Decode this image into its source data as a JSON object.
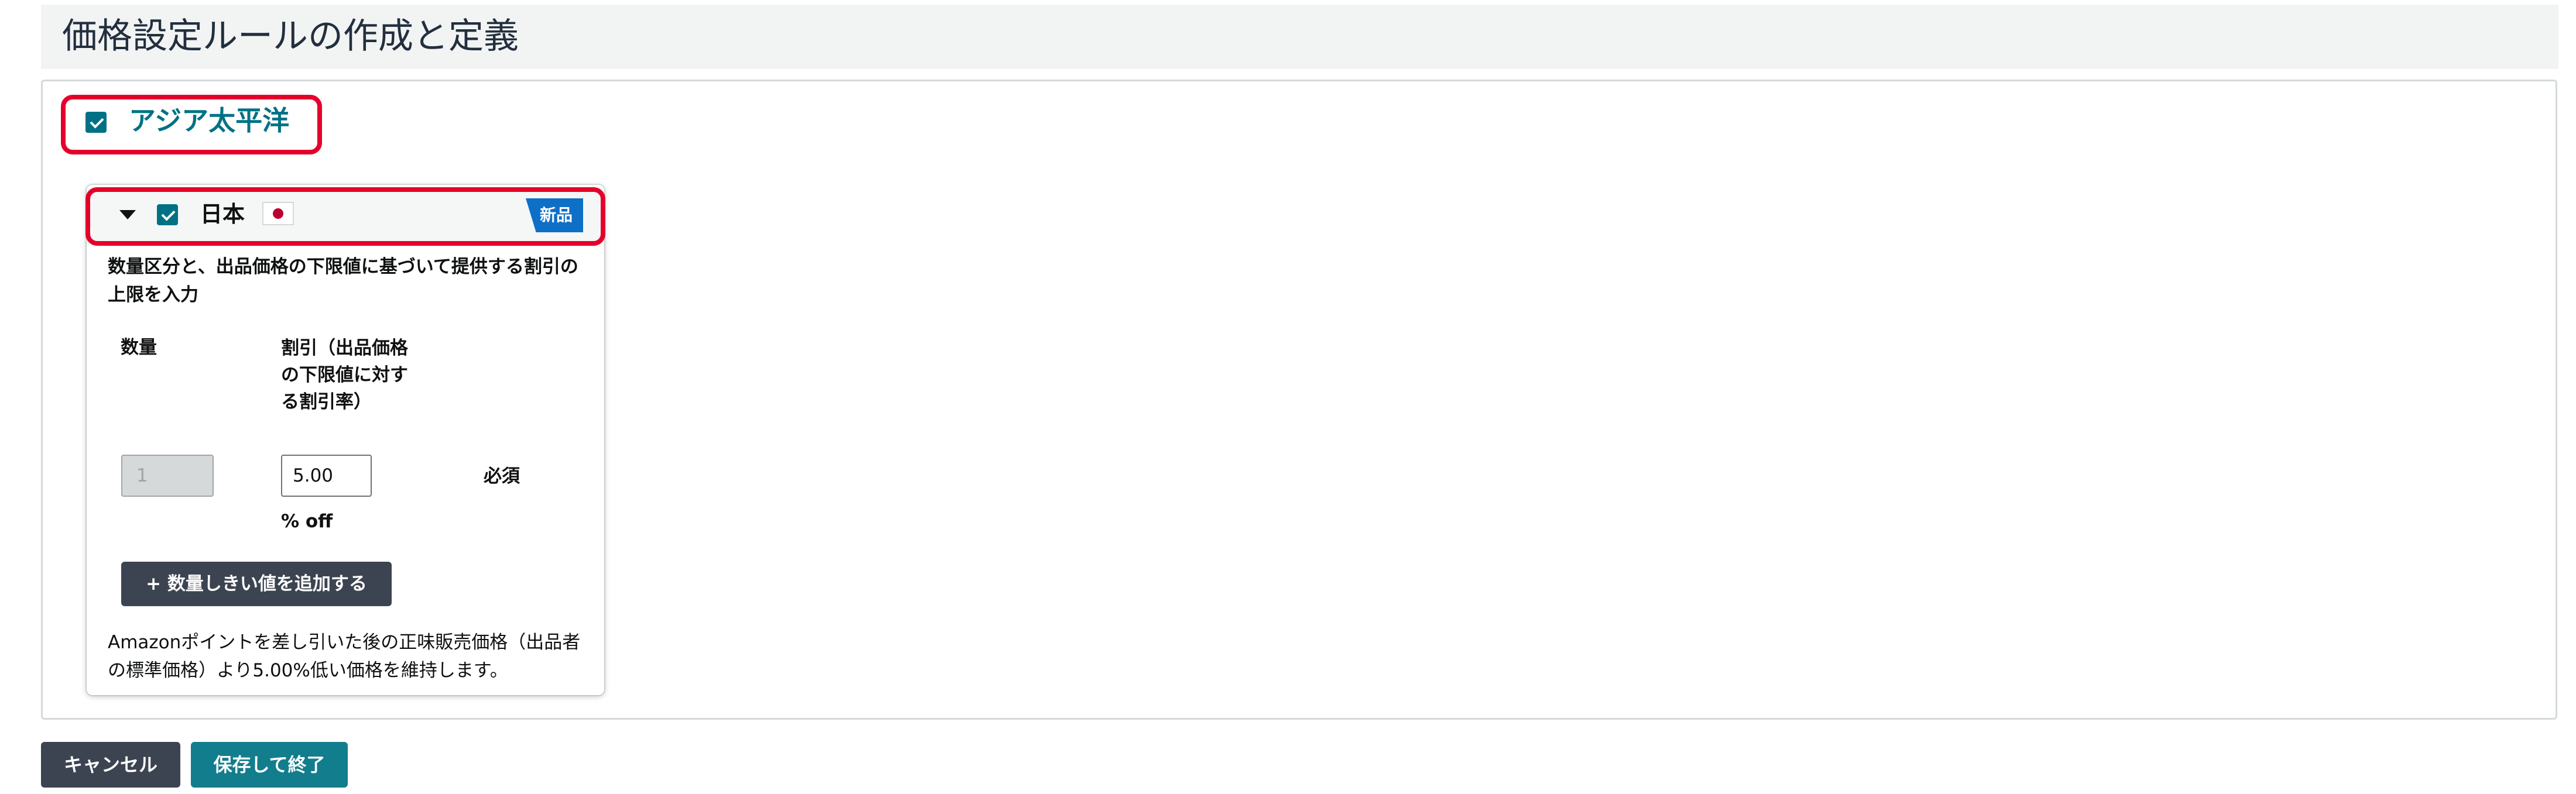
{
  "page": {
    "title": "価格設定ルールの作成と定義"
  },
  "region": {
    "label": "アジア太平洋",
    "checked": true
  },
  "country": {
    "label": "日本",
    "checked": true,
    "expanded": true,
    "flag_icon": "japan-flag-icon",
    "badge": "新品",
    "instructions": "数量区分と、出品価格の下限値に基づいて提供する割引の上限を入力",
    "columns": {
      "quantity": "数量",
      "discount": "割引（出品価格の下限値に対する割引率）"
    },
    "row": {
      "quantity_value": "1",
      "discount_value": "5.00",
      "required_label": "必須",
      "unit_label": "% off"
    },
    "add_threshold_label": "+ 数量しきい値を追加する",
    "footer_note": "Amazonポイントを差し引いた後の正味販売価格（出品者の標準価格）より5.00%低い価格を維持します。"
  },
  "actions": {
    "cancel_label": "キャンセル",
    "save_label": "保存して終了"
  },
  "colors": {
    "accent": "#007185",
    "highlight": "#e4002b",
    "badge": "#0e6fc7",
    "dark_button": "#3c4451",
    "save_button": "#127d8c"
  }
}
